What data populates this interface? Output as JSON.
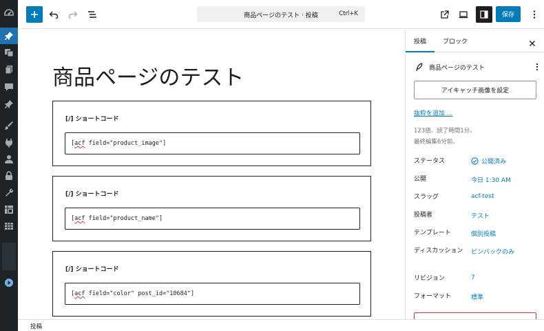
{
  "toolbar": {
    "command_title": "商品ページのテスト · 投稿",
    "command_shortcut": "Ctrl+K",
    "save_label": "保存"
  },
  "editor": {
    "title": "商品ページのテスト",
    "blocks": [
      {
        "label": "[/] ショートコード",
        "code_word": "acf",
        "code_rest": " field=\"product_image\"]"
      },
      {
        "label": "[/] ショートコード",
        "code_word": "acf",
        "code_rest": " field=\"product_name\"]"
      },
      {
        "label": "[/] ショートコード",
        "code_word": "acf",
        "code_rest": " field=\"color\" post_id=\"10684\"]"
      }
    ]
  },
  "footer": {
    "breadcrumb": "投稿"
  },
  "sidebar": {
    "tabs": {
      "post": "投稿",
      "block": "ブロック"
    },
    "doc_title": "商品ページのテスト",
    "featured_image_button": "アイキャッチ画像を設定",
    "excerpt_link": "抜粋を追加 ...",
    "meta_words": "123語、読了時間1分。",
    "meta_edited": "最終編集6分前。",
    "props": [
      {
        "label": "ステータス",
        "value": "公開済み"
      },
      {
        "label": "公開",
        "value": "今日 1:30 AM"
      },
      {
        "label": "スラッグ",
        "value": "acf-test"
      },
      {
        "label": "投稿者",
        "value": "テスト"
      },
      {
        "label": "テンプレート",
        "value": "個別投稿"
      },
      {
        "label": "ディスカッション",
        "value": "ピンバックのみ"
      },
      {
        "label": "リビジョン",
        "value": "7"
      },
      {
        "label": "フォーマット",
        "value": "標準"
      }
    ]
  }
}
